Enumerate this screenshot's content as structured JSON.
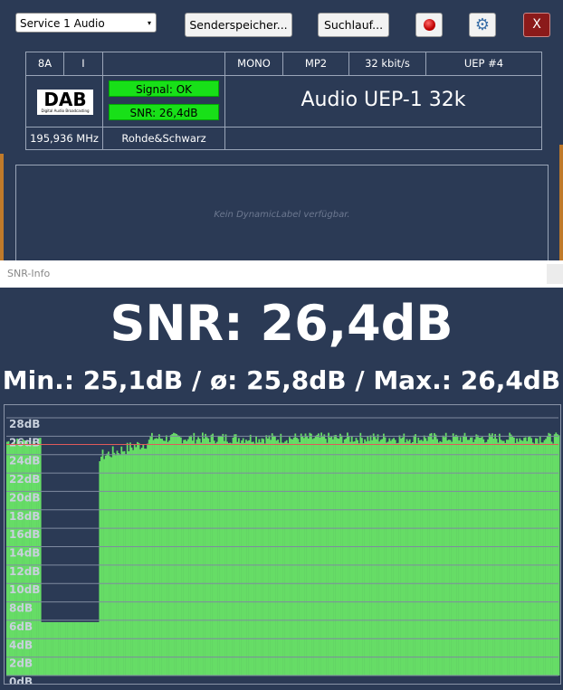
{
  "toolbar": {
    "service_select": "Service 1 Audio",
    "senderspeicher_label": "Senderspeicher...",
    "suchlauf_label": "Suchlauf...",
    "close_label": "X"
  },
  "info": {
    "channel": "8A",
    "ensemble_flag": "I",
    "mode": "MONO",
    "codec": "MP2",
    "bitrate": "32 kbit/s",
    "protection": "UEP #4",
    "signal": "Signal: OK",
    "snr": "SNR: 26,4dB",
    "service_label": "Audio UEP-1  32k",
    "frequency": "195,936 MHz",
    "ensemble_name": "Rohde&Schwarz",
    "dab_logo_text": "DAB",
    "dab_logo_subtext": "Digital Audio Broadcasting"
  },
  "dynamic_label": "Kein DynamicLabel verfügbar.",
  "snr_window": {
    "title": "SNR-Info",
    "snr_value_text": "SNR: 26,4dB",
    "stats_text": "Min.: 25,1dB / ø: 25,8dB / Max.: 26,4dB"
  },
  "colors": {
    "background": "#2b3a55",
    "bar_green": "#66dd66",
    "signal_green": "#18e018",
    "reference_line": "#e05a5a",
    "close_red": "#8b1a1a"
  },
  "chart_data": {
    "type": "bar",
    "ylim": [
      0,
      28
    ],
    "ytick_labels": [
      "28dB",
      "26dB",
      "24dB",
      "22dB",
      "20dB",
      "18dB",
      "16dB",
      "14dB",
      "12dB",
      "10dB",
      "8dB",
      "6dB",
      "4dB",
      "2dB",
      "0dB"
    ],
    "reference_value": 25.1,
    "segments": [
      {
        "name": "early",
        "approx_value": 25.4
      },
      {
        "name": "gap",
        "approx_value": 5.8
      },
      {
        "name": "main",
        "approx_value": 25.8
      }
    ],
    "grid": true
  }
}
